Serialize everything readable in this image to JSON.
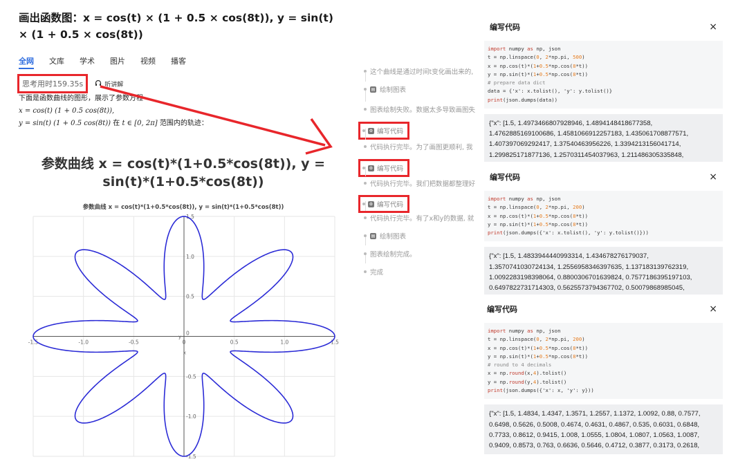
{
  "question": {
    "title": "画出函数图：x = cos(t) × (1 + 0.5 × cos(8t)), y = sin(t) × (1 + 0.5 × cos(8t))"
  },
  "tabs": [
    "全网",
    "文库",
    "学术",
    "图片",
    "视频",
    "播客"
  ],
  "thinking": {
    "time": "思考用时159.35s",
    "listen": "听讲解"
  },
  "answer": {
    "intro": "下面是函数曲线的图形，展示了参数方程",
    "eq_x": "x = cos(t) (1 + 0.5 cos(8t)),",
    "eq_y": "y = sin(t) (1 + 0.5 cos(8t))",
    "range_pre": "在",
    "range_math": "t ∈ [0, 2π]",
    "range_post": "范围内的轨迹："
  },
  "chart_titles": {
    "main": "参数曲线 x = cos(t)*(1+0.5*cos(8t)), y = sin(t)*(1+0.5*cos(8t))",
    "plot": "参数曲线 x = cos(t)*(1+0.5*cos(8t)), y = sin(t)*(1+0.5*cos(8t))"
  },
  "chart_data": {
    "type": "line",
    "title": "参数曲线 x = cos(t)*(1+0.5*cos(8t)), y = sin(t)*(1+0.5*cos(8t))",
    "xlabel": "x",
    "ylabel": "y",
    "xlim": [
      -1.5,
      1.5
    ],
    "ylim": [
      -1.5,
      1.5
    ],
    "xticks": [
      "-1.5",
      "-1.0",
      "-0.5",
      "0",
      "0.5",
      "1.0",
      "1.5"
    ],
    "yticks": [
      "1.5",
      "1.0",
      "0.5",
      "0",
      "-0.5",
      "-1.0",
      "-1.5"
    ],
    "grid": true,
    "series": [
      {
        "equation_x": "cos(t)*(1+0.5*cos(8t))",
        "equation_y": "sin(t)*(1+0.5*cos(8t))",
        "t_range": "[0, 2π]",
        "color": "#2b2bd6"
      }
    ]
  },
  "steps": [
    {
      "type": "text",
      "label": "这个曲线是通过时间t变化画出来的,"
    },
    {
      "type": "tool",
      "label": "绘制图表"
    },
    {
      "type": "text",
      "label": "图表绘制失败。数据太多导致画图失"
    },
    {
      "type": "tool",
      "label": "编写代码"
    },
    {
      "type": "text",
      "label": "代码执行完毕。为了画图更顺利, 我"
    },
    {
      "type": "tool",
      "label": "编写代码"
    },
    {
      "type": "text",
      "label": "代码执行完毕。我们把数据都整理好"
    },
    {
      "type": "tool",
      "label": "编写代码"
    },
    {
      "type": "text",
      "label": "代码执行完毕。有了x和y的数据, 就"
    },
    {
      "type": "tool",
      "label": "绘制图表"
    },
    {
      "type": "text",
      "label": "图表绘制完成。"
    },
    {
      "type": "text",
      "label": "完成"
    }
  ],
  "panels": [
    {
      "title": "编写代码",
      "close": "×",
      "code": [
        "import numpy as np, json",
        "t = np.linspace(0, 2*np.pi, 500)",
        "x = np.cos(t)*(1+0.5*np.cos(8*t))",
        "y = np.sin(t)*(1+0.5*np.cos(8*t))",
        "# prepare data dict",
        "data = {'x': x.tolist(), 'y': y.tolist()}",
        "print(json.dumps(data))"
      ],
      "output": [
        "{\"x\": [1.5, 1.4973466807928946, 1.4894148418677358,",
        "1.4762885169100686, 1.4581066912257183, 1.435061708877571,",
        "1.407397069292417, 1.37540463956226, 1.3394213156041714,",
        "1.299825171877136, 1.2570311454037963, 1.211486305335848,"
      ]
    },
    {
      "title": "编写代码",
      "close": "×",
      "code": [
        "import numpy as np, json",
        "t = np.linspace(0, 2*np.pi, 200)",
        "x = np.cos(t)*(1+0.5*np.cos(8*t))",
        "y = np.sin(t)*(1+0.5*np.cos(8*t))",
        "print(json.dumps({'x': x.tolist(), 'y': y.tolist()}))"
      ],
      "output": [
        "{\"x\": [1.5, 1.4833944440993314, 1.434678276179037,",
        "1.3570741030724134, 1.2556958346397635, 1.137183139762319,",
        "1.0092283198398064, 0.8800306701639824, 0.7577186395197103,",
        "0.6497822731714303, 0.5625573794367702, 0.50079868985045,"
      ]
    },
    {
      "title": "编写代码",
      "close": "×",
      "code": [
        "import numpy as np, json",
        "t = np.linspace(0, 2*np.pi, 200)",
        "x = np.cos(t)*(1+0.5*np.cos(8*t))",
        "y = np.sin(t)*(1+0.5*np.cos(8*t))",
        "# round to 4 decimals",
        "x = np.round(x,4).tolist()",
        "y = np.round(y,4).tolist()",
        "print(json.dumps({'x': x, 'y': y}))"
      ],
      "output": [
        "{\"x\": [1.5, 1.4834, 1.4347, 1.3571, 1.2557, 1.1372, 1.0092, 0.88, 0.7577,",
        "0.6498, 0.5626, 0.5008, 0.4674, 0.4631, 0.4867, 0.535, 0.6031, 0.6848,",
        "0.7733, 0.8612, 0.9415, 1.008, 1.0555, 1.0804, 1.0807, 1.0563, 1.0087,",
        "0.9409, 0.8573, 0.763, 0.6636, 0.5646, 0.4712, 0.3877, 0.3173, 0.2618,"
      ]
    }
  ],
  "colors": {
    "accent": "#2d6cdf",
    "annotation_red": "#e8262b",
    "curve": "#2b2bd6"
  }
}
